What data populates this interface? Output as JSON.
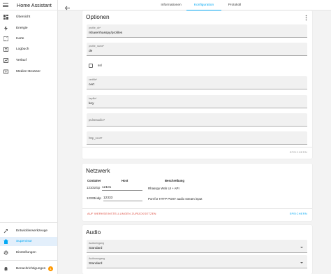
{
  "app": {
    "title": "Home Assistant"
  },
  "sidebar": {
    "items": [
      {
        "label": "Übersicht",
        "icon": "dashboard-icon"
      },
      {
        "label": "Energie",
        "icon": "lightning-icon"
      },
      {
        "label": "Karte",
        "icon": "map-icon"
      },
      {
        "label": "Logbuch",
        "icon": "logbook-icon"
      },
      {
        "label": "Verlauf",
        "icon": "history-chart-icon"
      },
      {
        "label": "Medien-Browser",
        "icon": "media-play-icon"
      }
    ],
    "bottom_items": [
      {
        "label": "Entwicklerwerkzeuge",
        "icon": "hammer-icon"
      },
      {
        "label": "Supervisor",
        "icon": "home-assistant-icon",
        "active": true
      },
      {
        "label": "Einstellungen",
        "icon": "gear-icon"
      }
    ],
    "notifications": {
      "label": "Benachrichtigungen",
      "count": "1"
    }
  },
  "topbar": {
    "tabs": [
      {
        "label": "Informationen"
      },
      {
        "label": "Konfiguration",
        "active": true
      },
      {
        "label": "Protokoll"
      }
    ]
  },
  "options_card": {
    "title": "Optionen",
    "fields": [
      {
        "label": "profile_dir*",
        "value": "/share/rhasspy/profiles"
      },
      {
        "label": "profile_name*",
        "value": "de"
      }
    ],
    "ssl_checkbox": {
      "label": "ssl",
      "checked": false
    },
    "fields2": [
      {
        "label": "certfile*",
        "value": "cert"
      },
      {
        "label": "keyfile*",
        "value": "key"
      }
    ],
    "optional_fields": [
      {
        "placeholder": "pulseaudio?"
      },
      {
        "placeholder": "http_root?"
      }
    ],
    "save_label": "SPEICHERN"
  },
  "network_card": {
    "title": "Netzwerk",
    "headers": {
      "container": "Container",
      "host": "Host",
      "description": "Beschreibung"
    },
    "rows": [
      {
        "container": "12101/tcp",
        "host": "12101",
        "description": "Rhasspy Web UI + API"
      },
      {
        "container": "12333/udp",
        "host": "12333",
        "description": "Port for HTTP POST audio stream input"
      }
    ],
    "reset_label": "AUF WERKSEINSTELLUNGEN ZURÜCKSETZEN",
    "save_label": "SPEICHERN"
  },
  "audio_card": {
    "title": "Audio",
    "input": {
      "label": "Audioeingang",
      "value": "Standard"
    },
    "output": {
      "label": "Audioausgang",
      "value": "Standard"
    }
  },
  "colors": {
    "accent": "#03a9f4",
    "reset": "#db4437",
    "badge": "#ff9800"
  }
}
